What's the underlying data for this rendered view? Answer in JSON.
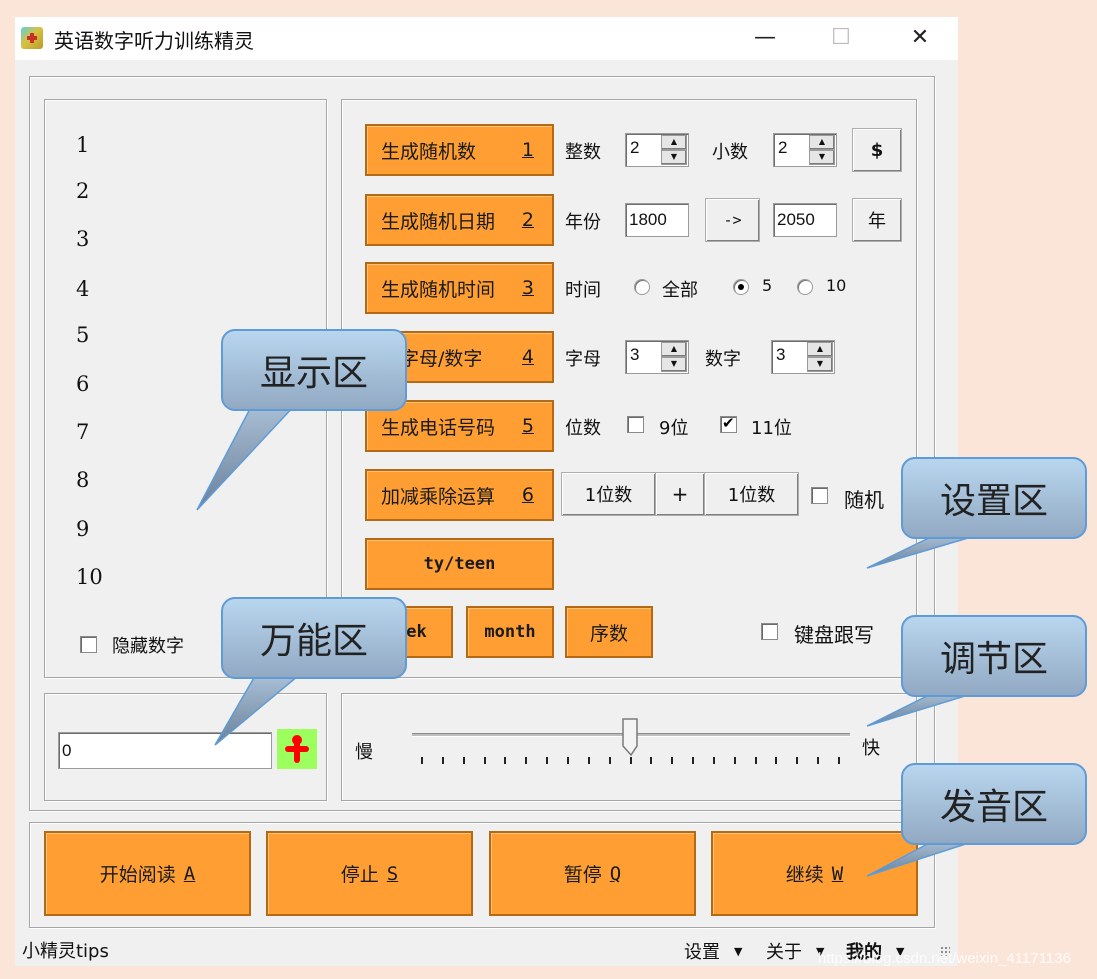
{
  "window": {
    "title": "英语数字听力训练精灵",
    "controls": {
      "minimize": "—",
      "maximize": "☐",
      "close": "✕"
    }
  },
  "display": {
    "numbers": [
      "1",
      "2",
      "3",
      "4",
      "5",
      "6",
      "7",
      "8",
      "9",
      "10"
    ],
    "hide_numbers_label": "隐藏数字",
    "hide_numbers_checked": false
  },
  "settings": {
    "random_number": {
      "label": "生成随机数",
      "key": "1",
      "integer_label": "整数",
      "integer_value": "2",
      "decimal_label": "小数",
      "decimal_value": "2",
      "currency_button": "$"
    },
    "random_date": {
      "label": "生成随机日期",
      "key": "2",
      "year_label": "年份",
      "from_year": "1800",
      "arrow_button": "->",
      "to_year": "2050",
      "year_button": "年"
    },
    "random_time": {
      "label": "生成随机时间",
      "key": "3",
      "time_label": "时间",
      "options": [
        {
          "label": "全部",
          "checked": false
        },
        {
          "label": "5",
          "checked": true
        },
        {
          "label": "10",
          "checked": false
        }
      ]
    },
    "letters_digits": {
      "label": "成字母/数字",
      "key": "4",
      "letters_label": "字母",
      "letters_value": "3",
      "digits_label": "数字",
      "digits_value": "3"
    },
    "phone": {
      "label": "生成电话号码",
      "key": "5",
      "digits_label": "位数",
      "options": [
        {
          "label": "9位",
          "checked": false
        },
        {
          "label": "11位",
          "checked": true
        }
      ]
    },
    "arithmetic": {
      "label": "加减乘除运算",
      "key": "6",
      "left_operand": "1位数",
      "operator": "+",
      "right_operand": "1位数",
      "random_label": "随机",
      "random_checked": false
    },
    "ty_teen": "ty/teen",
    "week": "ek",
    "month": "month",
    "ordinal": "序数",
    "keyboard_follow_label": "键盘跟写",
    "keyboard_follow_checked": false
  },
  "universal": {
    "input_value": "0",
    "icon": "red-figure-icon"
  },
  "adjust": {
    "slow_label": "慢",
    "fast_label": "快",
    "speed_fraction": 0.5,
    "tick_count": 21
  },
  "sound": {
    "buttons": [
      {
        "label": "开始阅读",
        "key": "A"
      },
      {
        "label": "停止",
        "key": "S"
      },
      {
        "label": "暂停",
        "key": "Q"
      },
      {
        "label": "继续",
        "key": "W"
      }
    ]
  },
  "statusbar": {
    "tips": "小精灵tips",
    "menus": [
      "设置",
      "关于",
      "我的"
    ]
  },
  "callouts": {
    "display": "显示区",
    "settings": "设置区",
    "universal": "万能区",
    "adjust": "调节区",
    "sound": "发音区"
  },
  "watermark": "https://blog.csdn.net/weixin_41171136",
  "colors": {
    "accent_orange": "#ff9f33",
    "green_button": "#9dff5e",
    "callout_blue": "#a8c4e0",
    "page_bg": "#fbe5d9"
  }
}
